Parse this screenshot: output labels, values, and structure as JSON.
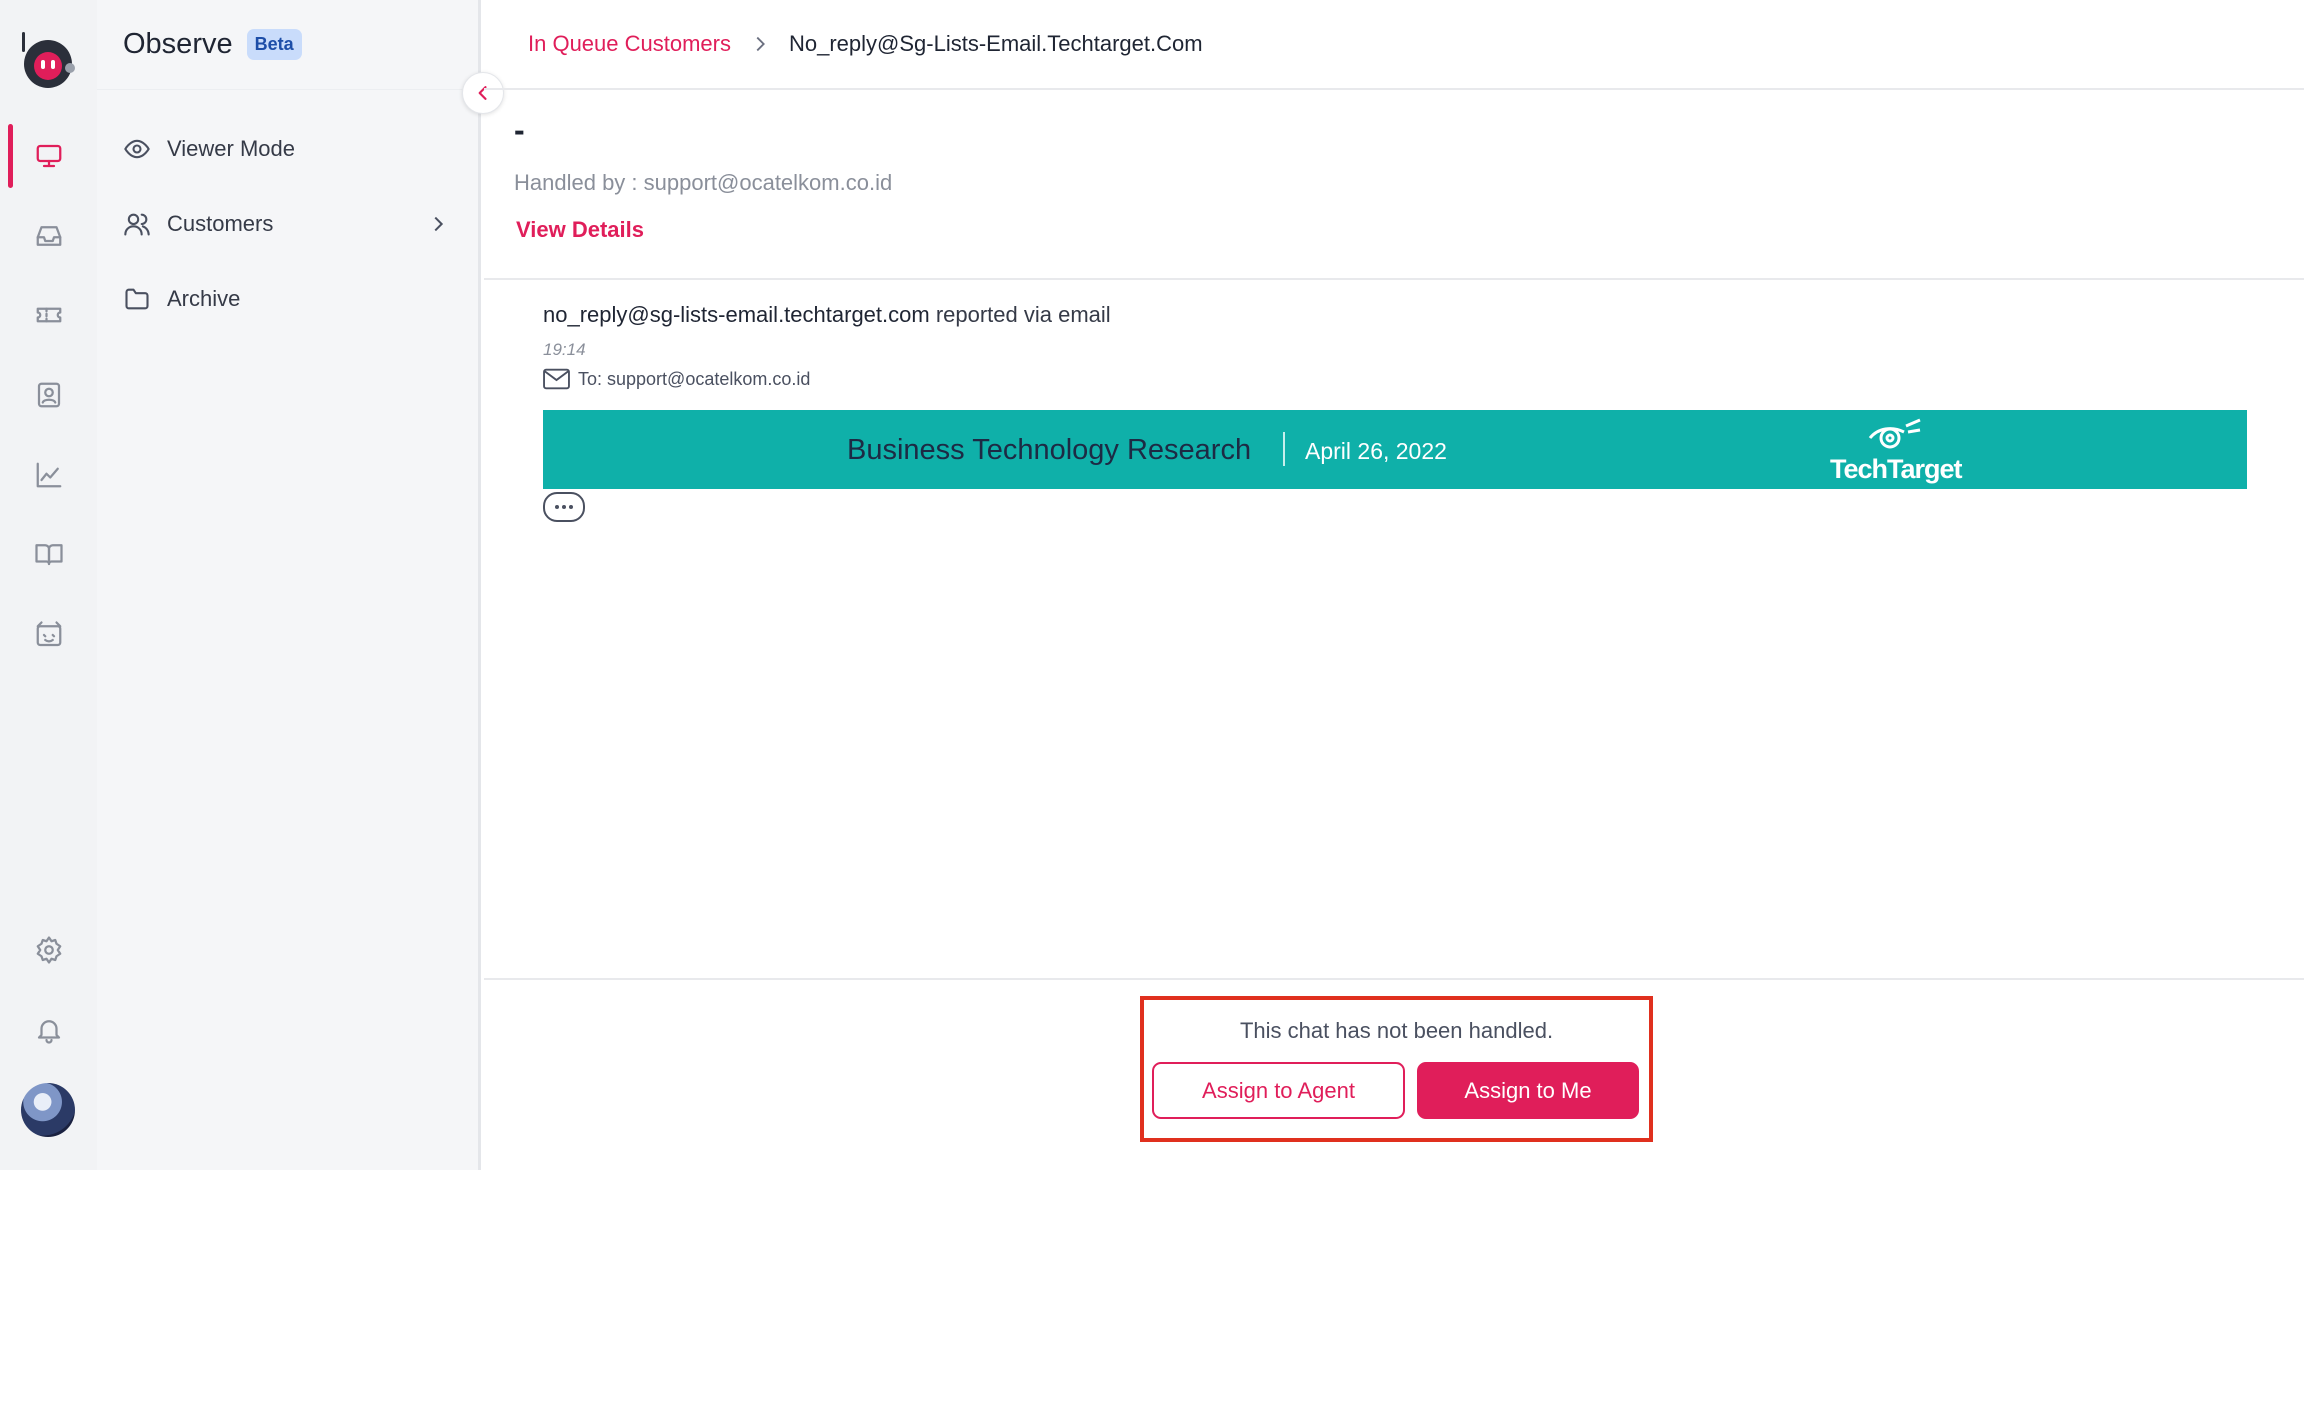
{
  "app": {
    "module_title": "Observe",
    "module_badge": "Beta"
  },
  "rail": {
    "items": [
      {
        "icon": "monitor-icon",
        "active": true
      },
      {
        "icon": "inbox-icon",
        "active": false
      },
      {
        "icon": "ticket-icon",
        "active": false
      },
      {
        "icon": "contact-icon",
        "active": false
      },
      {
        "icon": "analytics-icon",
        "active": false
      },
      {
        "icon": "knowledge-book-icon",
        "active": false
      },
      {
        "icon": "bot-icon",
        "active": false
      }
    ],
    "bottom_items": [
      "settings-icon",
      "bell-icon",
      "avatar"
    ]
  },
  "sidebar": {
    "items": [
      {
        "label": "Viewer Mode",
        "icon": "eye-icon"
      },
      {
        "label": "Customers",
        "icon": "users-icon",
        "has_submenu": true
      },
      {
        "label": "Archive",
        "icon": "folder-icon"
      }
    ]
  },
  "breadcrumb": {
    "parent": "In Queue Customers",
    "current": "No_reply@Sg-Lists-Email.Techtarget.Com"
  },
  "ticket": {
    "title": "-",
    "handled_by": "Handled by : support@ocatelkom.co.id",
    "view_details": "View Details"
  },
  "message": {
    "sender": "no_reply@sg-lists-email.techtarget.com",
    "channel_text": " reported via email",
    "time": "19:14",
    "to": "To: support@ocatelkom.co.id",
    "banner": {
      "heading": "Business Technology Research",
      "date": "April 26, 2022",
      "logo_text": "TechTarget",
      "color": "#0fb0a9"
    }
  },
  "footer": {
    "note": "This chat has not been handled.",
    "assign_agent": "Assign to Agent",
    "assign_me": "Assign to Me"
  },
  "colors": {
    "accent": "#e01e5a",
    "highlight_border": "#e0301e"
  }
}
